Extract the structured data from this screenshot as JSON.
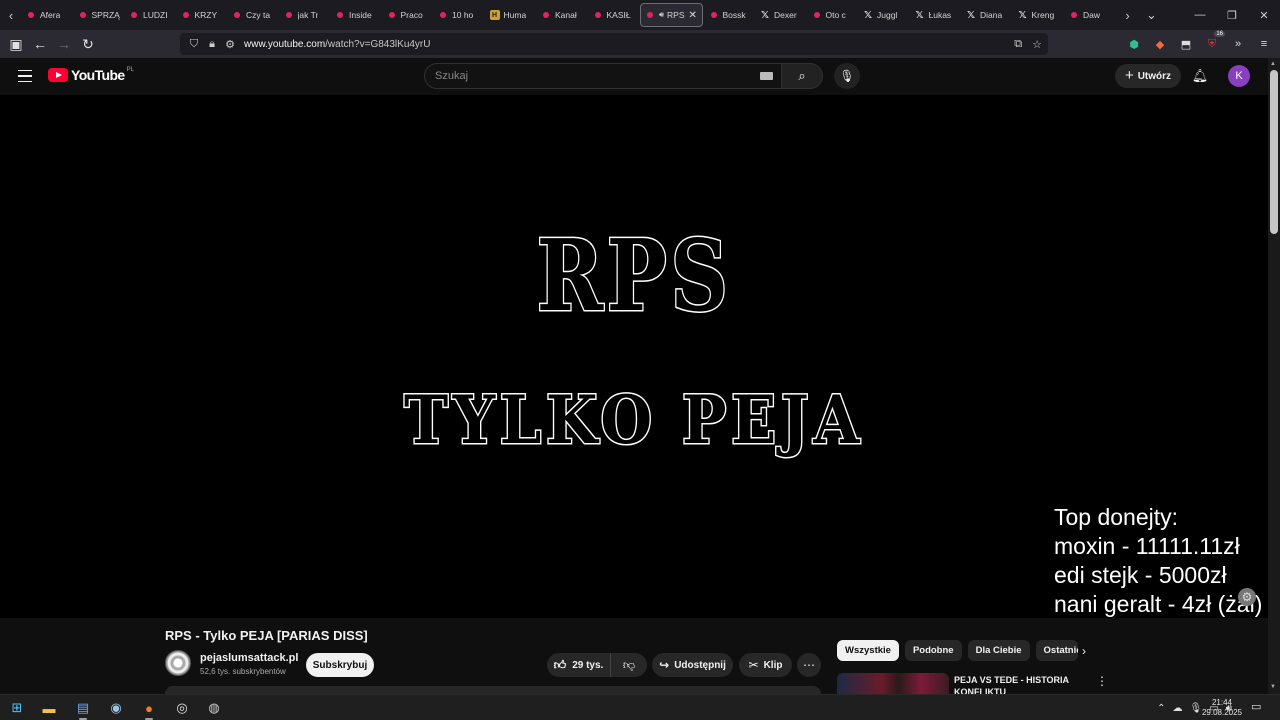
{
  "browser": {
    "tabs": [
      {
        "title": "Afera",
        "icon": "youtube-icon"
      },
      {
        "title": "SPRZĄ",
        "icon": "youtube-icon"
      },
      {
        "title": "LUDZI",
        "icon": "youtube-icon"
      },
      {
        "title": "KRZY",
        "icon": "youtube-icon"
      },
      {
        "title": "Czy ta",
        "icon": "youtube-icon"
      },
      {
        "title": "jak Tr",
        "icon": "youtube-icon"
      },
      {
        "title": "Inside",
        "icon": "youtube-icon"
      },
      {
        "title": "Praco",
        "icon": "youtube-icon"
      },
      {
        "title": "10 ho",
        "icon": "youtube-icon"
      },
      {
        "title": "Huma",
        "icon": "humble-bundle-icon"
      },
      {
        "title": "Kanał",
        "icon": "youtube-icon"
      },
      {
        "title": "KASIŁ",
        "icon": "youtube-icon"
      },
      {
        "title": "RPS",
        "icon": "youtube-icon",
        "active": true
      },
      {
        "title": "Bossk",
        "icon": "youtube-icon"
      },
      {
        "title": "Dexer",
        "icon": "x-icon"
      },
      {
        "title": "Oto c",
        "icon": "youtube-icon"
      },
      {
        "title": "Juggl",
        "icon": "x-icon"
      },
      {
        "title": "Łukas",
        "icon": "x-icon"
      },
      {
        "title": "Diana",
        "icon": "x-icon"
      },
      {
        "title": "Kreng",
        "icon": "x-icon"
      },
      {
        "title": "Daw",
        "icon": "youtube-icon"
      }
    ],
    "url_host": "www.youtube.com",
    "url_path": "/watch?v=G843lKu4yrU",
    "extension_badge": "16"
  },
  "youtube": {
    "logo_text": "YouTube",
    "region": "PL",
    "search_placeholder": "Szukaj",
    "create_label": "Utwórz",
    "avatar_letter": "K",
    "avatar_color": "#8a3fc1"
  },
  "video": {
    "frame_title": "RPS",
    "frame_subtitle": "TYLKO PEJA",
    "donations": {
      "header": "Top donejty:",
      "entries": [
        "moxin - 11111.11zł",
        "edi stejk - 5000zł",
        "nani geralt - 4zł (żal)"
      ]
    },
    "title": "RPS - Tylko PEJA [PARIAS DISS]",
    "channel_name": "pejaslumsattack.pl",
    "subscribers": "52,6 tys. subskrybentów",
    "subscribe_label": "Subskrybuj",
    "likes": "29 tys.",
    "share_label": "Udostępnij",
    "clip_label": "Klip"
  },
  "sidebar": {
    "chips": [
      "Wszystkie",
      "Podobne",
      "Dla Ciebie",
      "Ostatnio"
    ],
    "recommendation_title": "PEJA VS TEDE - HISTORIA KONFLIKTU"
  },
  "taskbar": {
    "time": "21:44",
    "date": "29.08.2025"
  }
}
